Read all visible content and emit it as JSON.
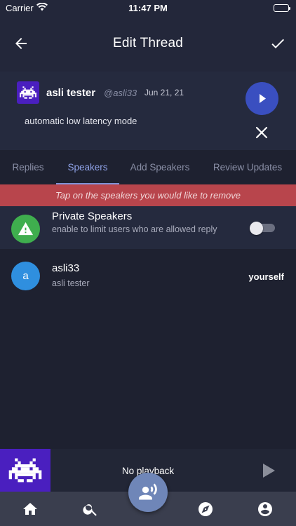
{
  "status_bar": {
    "carrier": "Carrier",
    "time": "11:47 PM"
  },
  "header": {
    "title": "Edit Thread"
  },
  "thread": {
    "author_name": "asli tester",
    "author_handle": "@asli33",
    "date": "Jun 21, 21",
    "text": "automatic low latency mode"
  },
  "tabs": [
    {
      "label": "Replies"
    },
    {
      "label": "Speakers",
      "active": true
    },
    {
      "label": "Add Speakers"
    },
    {
      "label": "Review Updates"
    }
  ],
  "banner": {
    "text": "Tap on the speakers you would like to remove"
  },
  "private_speakers": {
    "title": "Private Speakers",
    "description": "enable to limit users who are allowed reply",
    "enabled": false
  },
  "speakers": [
    {
      "initial": "a",
      "handle": "asli33",
      "name": "asli tester",
      "tag": "yourself"
    }
  ],
  "player": {
    "status": "No playback"
  },
  "colors": {
    "accent": "#3a4fc0",
    "banner": "#b8454c",
    "warning_green": "#3fae4e",
    "avatar_blue": "#2f8fdf",
    "avatar_purple": "#4a1fbf",
    "active_tab": "#8fa2e8"
  },
  "icons": {
    "header_back": "arrow-left-icon",
    "header_confirm": "check-icon",
    "thread_play": "play-icon",
    "thread_close": "close-icon",
    "private": "warning-icon",
    "nav": [
      "home-icon",
      "search-icon",
      "compass-icon",
      "account-icon"
    ],
    "fab": "record-voice-icon"
  }
}
